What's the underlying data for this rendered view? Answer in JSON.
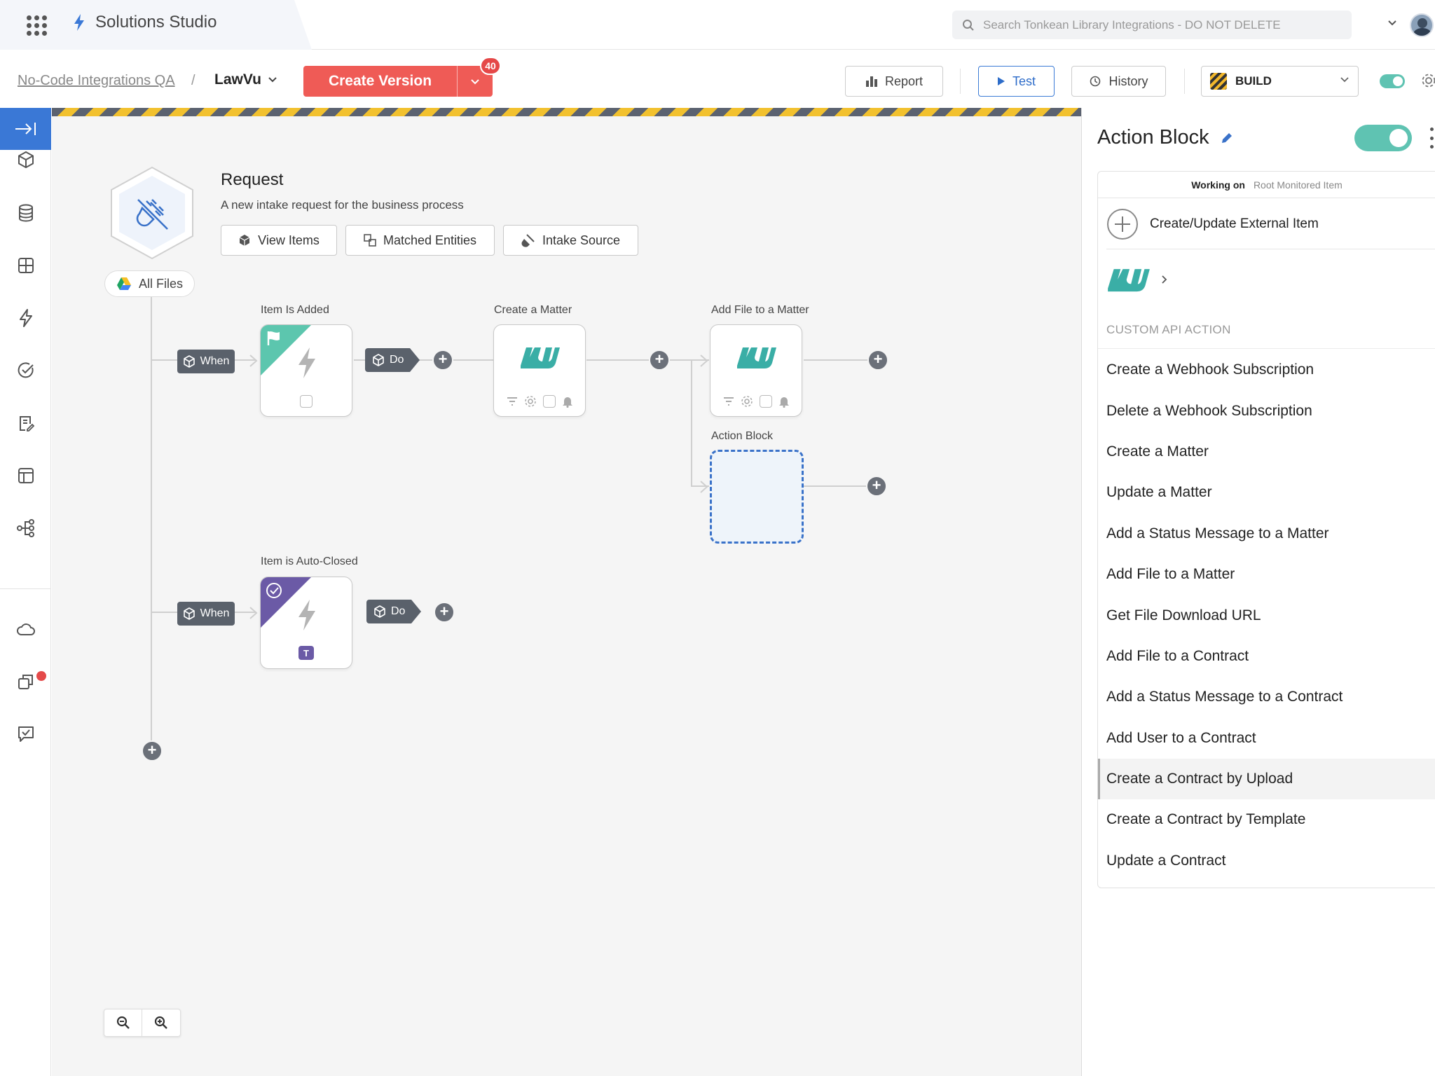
{
  "topbar": {
    "app_title": "Solutions Studio",
    "search_placeholder": "Search Tonkean Library Integrations - DO NOT DELETE"
  },
  "subbar": {
    "breadcrumb_root": "No-Code Integrations QA",
    "breadcrumb_separator": "/",
    "breadcrumb_current": "LawVu",
    "create_version_label": "Create Version",
    "create_version_badge": "40",
    "report_label": "Report",
    "test_label": "Test",
    "history_label": "History",
    "environment_label": "BUILD",
    "live_toggle_on": true
  },
  "colors": {
    "accent_blue": "#3a78d6",
    "create_red": "#ef5b56",
    "toggle_teal": "#5fc3b2",
    "lawvu_teal": "#3aaea6",
    "autoclose_purple": "#6b5aa6"
  },
  "trigger": {
    "title": "Request",
    "description": "A new intake request for the business process",
    "buttons": [
      "View Items",
      "Matched Entities",
      "Intake Source"
    ],
    "source_label": "All Files"
  },
  "flow": {
    "when_label": "When",
    "do_label": "Do",
    "nodes": {
      "item_added": "Item Is Added",
      "create_matter": "Create a Matter",
      "add_file": "Add File to a Matter",
      "action_block": "Action Block",
      "auto_closed": "Item is Auto-Closed"
    },
    "auto_closed_tag": "T",
    "plus_symbol": "+"
  },
  "panel": {
    "title": "Action Block",
    "enabled": true,
    "working_on_label": "Working on",
    "working_on_value": "Root Monitored Item",
    "external_item_label": "Create/Update External Item",
    "custom_header": "CUSTOM API ACTION",
    "actions": [
      "Create a Webhook Subscription",
      "Delete a Webhook Subscription",
      "Create a Matter",
      "Update a Matter",
      "Add a Status Message to a Matter",
      "Add File to a Matter",
      "Get File Download URL",
      "Add File to a Contract",
      "Add a Status Message to a Contract",
      "Add User to a Contract",
      "Create a Contract by Upload",
      "Create a Contract by Template",
      "Update a Contract"
    ],
    "hovered_action": "Create a Contract by Upload"
  },
  "icons": {
    "rail": [
      "collapse-icon",
      "cube-icon",
      "database-icon",
      "grid-icon",
      "bolt-icon",
      "check-circle-icon",
      "form-icon",
      "layout-icon",
      "tree-icon",
      "cloud-icon",
      "copy-icon",
      "chat-check-icon"
    ]
  }
}
